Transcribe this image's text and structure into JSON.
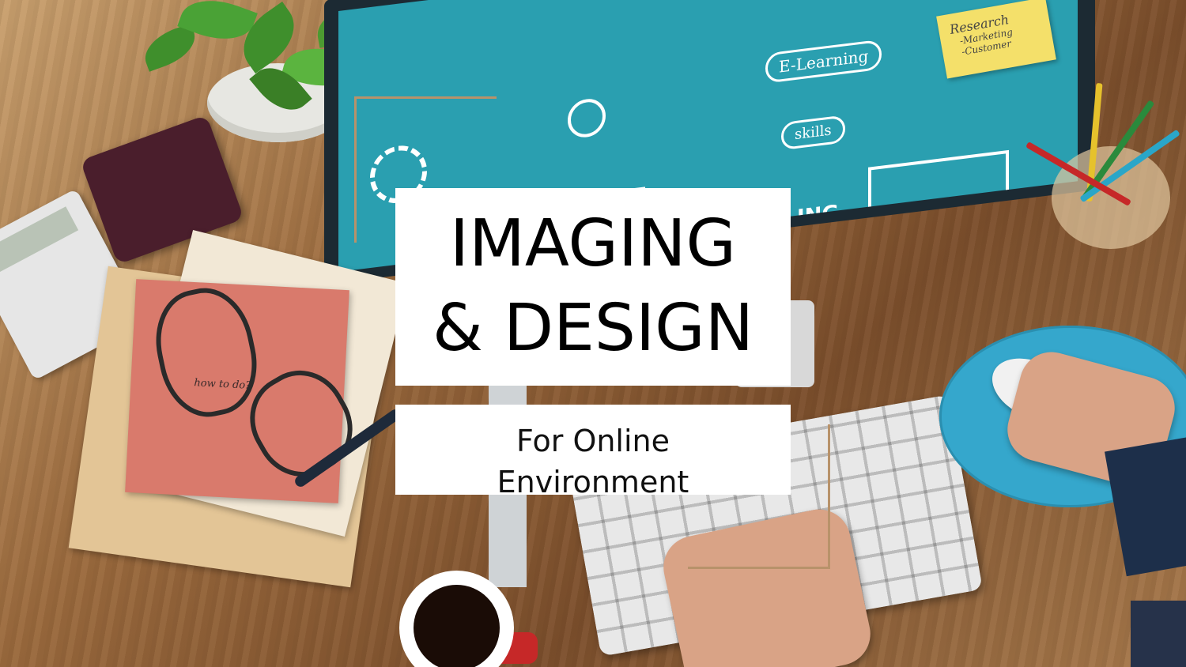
{
  "slide": {
    "title_line1": "IMAGING",
    "title_line2": "& DESIGN",
    "subtitle_line1": "For Online",
    "subtitle_line2": "Environment"
  },
  "background_photo": {
    "screen_text": [
      "E-Learning",
      "skills",
      "ING"
    ],
    "sticky_note": [
      "Research",
      "-Marketing",
      "-Customer"
    ],
    "note_text": "how to do?"
  },
  "colors": {
    "accent_line": "#b8926a",
    "title_box": "#ffffff",
    "title_text": "#000000",
    "screen": "#2a9fb0"
  }
}
